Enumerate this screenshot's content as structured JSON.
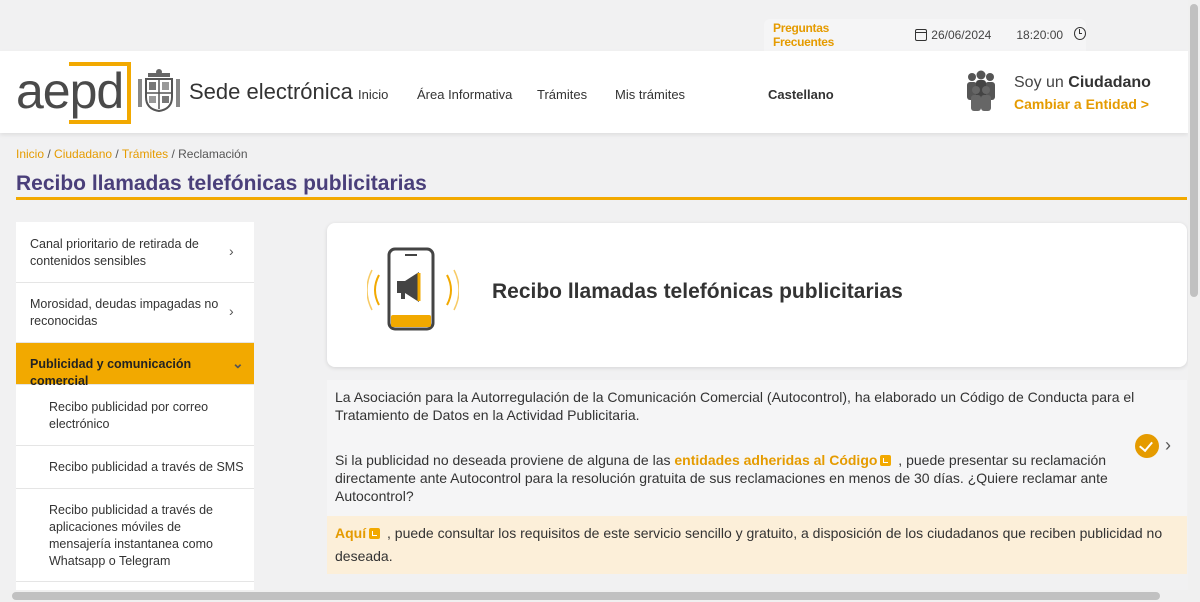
{
  "topbar": {
    "faq": "Preguntas Frecuentes",
    "date": "26/06/2024",
    "time": "18:20:00"
  },
  "header": {
    "logo": "aepd",
    "site_name": "Sede electrónica",
    "nav": [
      "Inicio",
      "Área Informativa",
      "Trámites",
      "Mis trámites"
    ],
    "language": "Castellano",
    "profile_prefix": "Soy un ",
    "profile_role": "Ciudadano",
    "switch_link": "Cambiar a Entidad >"
  },
  "breadcrumb": {
    "items": [
      "Inicio",
      "Ciudadano",
      "Trámites"
    ],
    "current": "Reclamación"
  },
  "page_title": "Recibo llamadas telefónicas publicitarias",
  "sidebar": {
    "items": [
      {
        "label": "Canal prioritario de retirada de contenidos sensibles"
      },
      {
        "label": "Morosidad, deudas impagadas no reconocidas"
      },
      {
        "label": "Publicidad y comunicación comercial"
      },
      {
        "label": "Recibo publicidad por correo electrónico"
      },
      {
        "label": "Recibo publicidad a través de SMS"
      },
      {
        "label": "Recibo publicidad a través de aplicaciones móviles de mensajería instantanea como Whatsapp o Telegram"
      }
    ]
  },
  "card": {
    "title": "Recibo llamadas telefónicas publicitarias"
  },
  "info": {
    "p1": "La Asociación para la Autorregulación de la Comunicación Comercial (Autocontrol), ha elaborado un Código de Conducta para el Tratamiento de Datos en la Actividad Publicitaria.",
    "p2_before": "Si la publicidad no deseada proviene de alguna de las ",
    "p2_link": "entidades adheridas al Código",
    "p2_after": " , puede presentar su reclamación directamente ante Autocontrol para la resolución gratuita de sus reclamaciones en menos de 30 días. ¿Quiere reclamar ante Autocontrol?",
    "p3_link": "Aquí",
    "p3_after": " , puede consultar los requisitos de este servicio sencillo y gratuito, a disposición de los ciudadanos que reciben publicidad no deseada."
  },
  "colors": {
    "accent": "#f2a900",
    "link": "#e59b00",
    "title": "#4a3f7a"
  }
}
